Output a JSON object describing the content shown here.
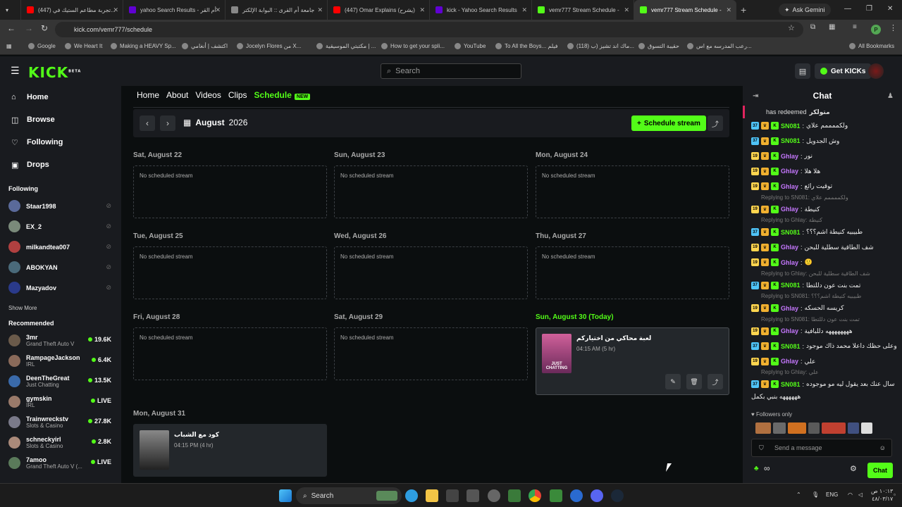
{
  "browser": {
    "tabs": [
      {
        "title": "(447) تجربة مطاعم الستيك في...",
        "color": "#ff0000"
      },
      {
        "title": "yahoo Search Results - أم القر",
        "color": "#6001d2"
      },
      {
        "title": "جامعة أم القرى :: البوابة الإلكتر",
        "color": "#888888"
      },
      {
        "title": "(447) Omar Explains (يشرح)",
        "color": "#ff0000"
      },
      {
        "title": "kick - Yahoo Search Results",
        "color": "#6001d2"
      },
      {
        "title": "vemr777 Stream Schedule - ",
        "color": "#53fc18"
      },
      {
        "title": "vemr777 Stream Schedule - ",
        "color": "#53fc18"
      }
    ],
    "ask_gemini": "Ask Gemini",
    "url": "kick.com/vemr777/schedule",
    "bookmarks": [
      "Google",
      "We Heart It",
      "Making a HEAVY Sp...",
      "اكتشف | أنغامي",
      "Jocelyn Flores من X...",
      "مكتبتي الموسيقية | ...",
      "How to get your spli...",
      "YouTube",
      "To All the Boys... فيلم",
      "(118) ماك اند تشيز (ب...",
      "حقيبة التسوق",
      "رعب المدرسه مع اس...",
      "All Bookmarks"
    ],
    "profile_initial": "P"
  },
  "header": {
    "logo": "KICK",
    "logo_beta": "BETA",
    "search_placeholder": "Search",
    "get_kicks": "Get KICKs"
  },
  "sidebar": {
    "nav": [
      {
        "label": "Home",
        "icon": "home-icon",
        "glyph": "⌂"
      },
      {
        "label": "Browse",
        "icon": "browse-icon",
        "glyph": "◫"
      },
      {
        "label": "Following",
        "icon": "heart-icon",
        "glyph": "♡"
      },
      {
        "label": "Drops",
        "icon": "gift-icon",
        "glyph": "▣"
      }
    ],
    "following_title": "Following",
    "following": [
      {
        "name": "Staar1998",
        "color": "#5a6a9a"
      },
      {
        "name": "EX_2",
        "color": "#7a8a7a"
      },
      {
        "name": "milkandtea007",
        "color": "#b04040"
      },
      {
        "name": "ABOKYAN",
        "color": "#4a6a7a"
      },
      {
        "name": "Mazyadov",
        "color": "#2a3a8a"
      }
    ],
    "show_more": "Show More",
    "recommended_title": "Recommended",
    "recommended": [
      {
        "name": "3mr",
        "category": "Grand Theft Auto V",
        "viewers": "19.6K",
        "color": "#6a5a4a"
      },
      {
        "name": "RampageJackson",
        "category": "IRL",
        "viewers": "6.4K",
        "color": "#8a6a5a"
      },
      {
        "name": "DeenTheGreat",
        "category": "Just Chatting",
        "viewers": "13.5K",
        "color": "#3a6aaa"
      },
      {
        "name": "gymskin",
        "category": "IRL",
        "viewers": "LIVE",
        "color": "#9a7a6a"
      },
      {
        "name": "Trainwreckstv",
        "category": "Slots & Casino",
        "viewers": "27.8K",
        "color": "#7a7a8a"
      },
      {
        "name": "schneckyirl",
        "category": "Slots & Casino",
        "viewers": "2.8K",
        "color": "#aa8a7a"
      },
      {
        "name": "7amoo",
        "category": "Grand Theft Auto V (...",
        "viewers": "LIVE",
        "color": "#5a7a5a"
      }
    ]
  },
  "profile_tabs": {
    "home": "Home",
    "about": "About",
    "videos": "Videos",
    "clips": "Clips",
    "schedule": "Schedule",
    "new_badge": "NEW"
  },
  "schedule": {
    "month": "August",
    "year": "2026",
    "schedule_button": "Schedule stream",
    "empty_text": "No scheduled stream",
    "days": [
      {
        "label": "Sat, August 22"
      },
      {
        "label": "Sun, August 23"
      },
      {
        "label": "Mon, August 24"
      },
      {
        "label": "Tue, August 25"
      },
      {
        "label": "Wed, August 26"
      },
      {
        "label": "Thu, August 27"
      },
      {
        "label": "Fri, August 28"
      },
      {
        "label": "Sat, August 29"
      },
      {
        "label": "Sun, August 30 (Today)",
        "event_title": "لعبة محاكي من اختياركم",
        "event_time": "04:15 AM (5 hr)",
        "thumb_text": "JUST CHATTING"
      },
      {
        "label": "Mon, August 31",
        "event_title": "كود مع الشباب",
        "event_time": "04:15 PM (4 hr)"
      }
    ]
  },
  "chat": {
    "title": "Chat",
    "redeemed": "has redeemed",
    "redeemed_item": "متولكر",
    "messages": [
      {
        "user": "SN081",
        "text": "ولكممممم علاي",
        "ucolor": "#53fc18",
        "b1": "#4fc3f7"
      },
      {
        "user": "SN081",
        "text": "وش الجدويل",
        "ucolor": "#53fc18",
        "b1": "#4fc3f7"
      },
      {
        "user": "Ghlay",
        "text": "نور",
        "ucolor": "#c678ff",
        "b1": "#ffd54f"
      },
      {
        "user": "Ghlay",
        "text": "هلا هلا",
        "ucolor": "#c678ff",
        "b1": "#ffd54f"
      },
      {
        "user": "Ghlay",
        "text": "توقيت رائع",
        "ucolor": "#c678ff",
        "b1": "#ffd54f"
      },
      {
        "reply": "Replying to SN081: ولكممممم علاي",
        "user": "Ghlay",
        "text": "كنيطة",
        "ucolor": "#c678ff",
        "b1": "#ffd54f"
      },
      {
        "reply": "Replying to Ghlay: كنيطة",
        "user": "SN081",
        "text": "طبيبيه كنيطة اشم؟؟؟",
        "ucolor": "#53fc18",
        "b1": "#4fc3f7"
      },
      {
        "user": "Ghlay",
        "text": "شف الطاقية سطلية للبحن",
        "ucolor": "#c678ff",
        "b1": "#ffd54f"
      },
      {
        "user": "Ghlay",
        "text": "🙂",
        "ucolor": "#c678ff",
        "b1": "#ffd54f"
      },
      {
        "reply": "Replying to Ghlay: شف الطاقية سطلية للبحن",
        "user": "SN081",
        "text": "تمت بنت عون دللتطا",
        "ucolor": "#53fc18",
        "b1": "#4fc3f7"
      },
      {
        "reply": "Replying to SN081: طبيبيه كنيطة اشم؟؟؟",
        "user": "Ghlay",
        "text": "كريسه الحسكه",
        "ucolor": "#c678ff",
        "b1": "#ffd54f"
      },
      {
        "reply": "Replying to SN081: تمت بنت عون دللتطا",
        "user": "Ghlay",
        "text": "ههههههههه دللبافية",
        "ucolor": "#c678ff",
        "b1": "#ffd54f"
      },
      {
        "user": "SN081",
        "text": "وعلى حظك داعلا محمد ذاك موجود",
        "ucolor": "#53fc18",
        "b1": "#4fc3f7"
      },
      {
        "user": "Ghlay",
        "text": "علي",
        "ucolor": "#c678ff",
        "b1": "#ffd54f"
      },
      {
        "reply": "Replying to Ghlay: علي",
        "user": "SN081",
        "text": "سال عنك بعد يقول ليه مو موجوده",
        "ucolor": "#53fc18",
        "b1": "#4fc3f7"
      }
    ],
    "last_line": "ههههههه بنبي بكمل",
    "followers_only": "Followers only",
    "send_placeholder": "Send a message",
    "chat_button": "Chat",
    "infinity": "∞"
  },
  "taskbar": {
    "search": "Search",
    "lang": "ENG",
    "time": "١٠:١٣ ص",
    "date": "٤٨/٠٣/١٧"
  }
}
